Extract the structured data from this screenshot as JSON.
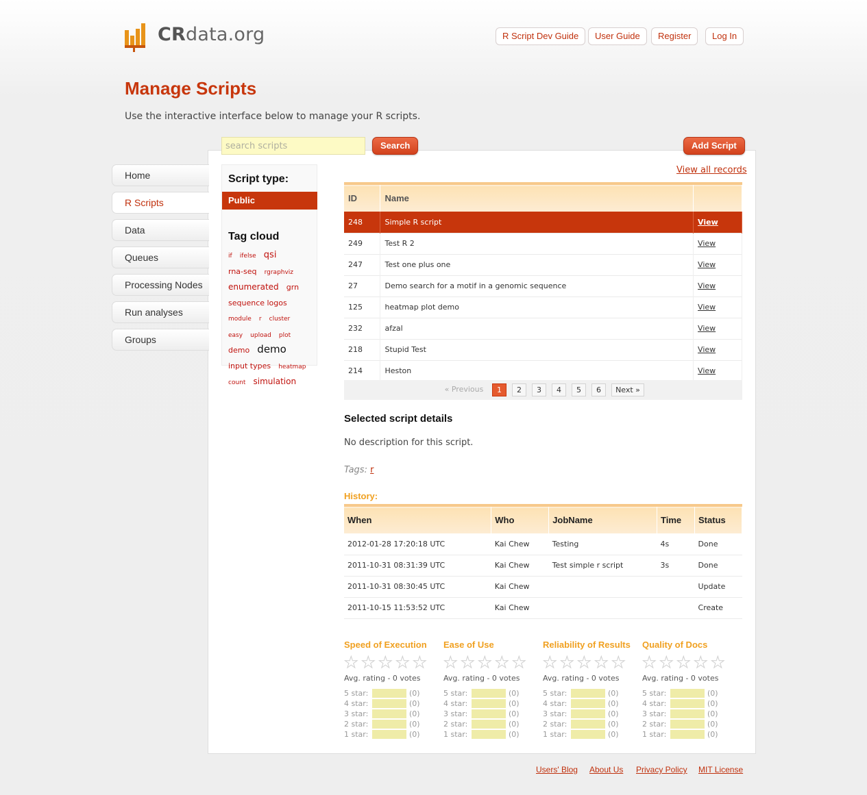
{
  "site": {
    "logo_bold": "CR",
    "logo_rest": "data.org"
  },
  "header_links": [
    "R Script Dev Guide",
    "User Guide",
    "Register",
    "Log In"
  ],
  "page": {
    "title": "Manage Scripts",
    "subtitle": "Use the interactive interface below to manage your R scripts."
  },
  "search": {
    "placeholder": "search scripts",
    "button": "Search"
  },
  "add_script": "Add Script",
  "nav": [
    "Home",
    "R Scripts",
    "Data",
    "Queues",
    "Processing Nodes",
    "Run analyses",
    "Groups"
  ],
  "nav_active": "R Scripts",
  "script_type": {
    "title": "Script type:",
    "selected": "Public"
  },
  "tag_cloud": {
    "title": "Tag cloud",
    "tags": [
      {
        "text": "if",
        "size": 9
      },
      {
        "text": "ifelse",
        "size": 9
      },
      {
        "text": "qsi",
        "size": 13
      },
      {
        "text": "rna-seq",
        "size": 11
      },
      {
        "text": "rgraphviz",
        "size": 9
      },
      {
        "text": "enumerated",
        "size": 12
      },
      {
        "text": "grn",
        "size": 11
      },
      {
        "text": "sequence logos",
        "size": 11
      },
      {
        "text": "module",
        "size": 9
      },
      {
        "text": "r",
        "size": 9
      },
      {
        "text": "cluster",
        "size": 9
      },
      {
        "text": "easy",
        "size": 9
      },
      {
        "text": "upload",
        "size": 9
      },
      {
        "text": "plot",
        "size": 9
      },
      {
        "text": "demo",
        "size": 11
      },
      {
        "text": "demo",
        "size": 15,
        "color": "#111111"
      },
      {
        "text": "input types",
        "size": 11
      },
      {
        "text": "heatmap",
        "size": 9
      },
      {
        "text": "count",
        "size": 9
      },
      {
        "text": "simulation",
        "size": 12
      }
    ]
  },
  "view_all": "View all records",
  "scripts_table": {
    "columns": [
      "ID",
      "Name",
      ""
    ],
    "rows": [
      {
        "id": "248",
        "name": "Simple R script",
        "action": "View",
        "selected": true
      },
      {
        "id": "249",
        "name": "Test R 2",
        "action": "View"
      },
      {
        "id": "247",
        "name": "Test one plus one",
        "action": "View"
      },
      {
        "id": "27",
        "name": "Demo search for a motif in a genomic sequence",
        "action": "View"
      },
      {
        "id": "125",
        "name": "heatmap plot demo",
        "action": "View"
      },
      {
        "id": "232",
        "name": "afzal",
        "action": "View"
      },
      {
        "id": "218",
        "name": "Stupid Test",
        "action": "View"
      },
      {
        "id": "214",
        "name": "Heston",
        "action": "View"
      }
    ]
  },
  "pagination": {
    "prev": "« Previous",
    "pages": [
      "1",
      "2",
      "3",
      "4",
      "5",
      "6"
    ],
    "current": "1",
    "next": "Next »"
  },
  "details": {
    "title": "Selected script details",
    "description": "No description for this script.",
    "tags_label": "Tags:",
    "tags": [
      "r"
    ]
  },
  "history": {
    "title": "History:",
    "columns": [
      "When",
      "Who",
      "JobName",
      "Time",
      "Status"
    ],
    "rows": [
      [
        "2012-01-28 17:20:18 UTC",
        "Kai Chew",
        "Testing",
        "4s",
        "Done"
      ],
      [
        "2011-10-31 08:31:39 UTC",
        "Kai Chew",
        "Test simple r script",
        "3s",
        "Done"
      ],
      [
        "2011-10-31 08:30:45 UTC",
        "Kai Chew",
        "",
        "",
        "Update"
      ],
      [
        "2011-10-15 11:53:52 UTC",
        "Kai Chew",
        "",
        "",
        "Create"
      ]
    ]
  },
  "ratings": [
    {
      "title": "Speed of Execution",
      "avg": "Avg. rating - 0 votes",
      "dist": [
        {
          "label": "5 star:",
          "count": "(0)"
        },
        {
          "label": "4 star:",
          "count": "(0)"
        },
        {
          "label": "3 star:",
          "count": "(0)"
        },
        {
          "label": "2 star:",
          "count": "(0)"
        },
        {
          "label": "1 star:",
          "count": "(0)"
        }
      ]
    },
    {
      "title": "Ease of Use",
      "avg": "Avg. rating - 0 votes",
      "dist": [
        {
          "label": "5 star:",
          "count": "(0)"
        },
        {
          "label": "4 star:",
          "count": "(0)"
        },
        {
          "label": "3 star:",
          "count": "(0)"
        },
        {
          "label": "2 star:",
          "count": "(0)"
        },
        {
          "label": "1 star:",
          "count": "(0)"
        }
      ]
    },
    {
      "title": "Reliability of Results",
      "avg": "Avg. rating - 0 votes",
      "dist": [
        {
          "label": "5 star:",
          "count": "(0)"
        },
        {
          "label": "4 star:",
          "count": "(0)"
        },
        {
          "label": "3 star:",
          "count": "(0)"
        },
        {
          "label": "2 star:",
          "count": "(0)"
        },
        {
          "label": "1 star:",
          "count": "(0)"
        }
      ]
    },
    {
      "title": "Quality of Docs",
      "avg": "Avg. rating - 0 votes",
      "dist": [
        {
          "label": "5 star:",
          "count": "(0)"
        },
        {
          "label": "4 star:",
          "count": "(0)"
        },
        {
          "label": "3 star:",
          "count": "(0)"
        },
        {
          "label": "2 star:",
          "count": "(0)"
        },
        {
          "label": "1 star:",
          "count": "(0)"
        }
      ]
    }
  ],
  "footer_links": [
    "Users' Blog",
    "About Us",
    "Privacy Policy",
    "MIT License"
  ],
  "colors": {
    "accent": "#c7360c",
    "orange": "#f0a020",
    "search_bg": "#fdfac5"
  }
}
